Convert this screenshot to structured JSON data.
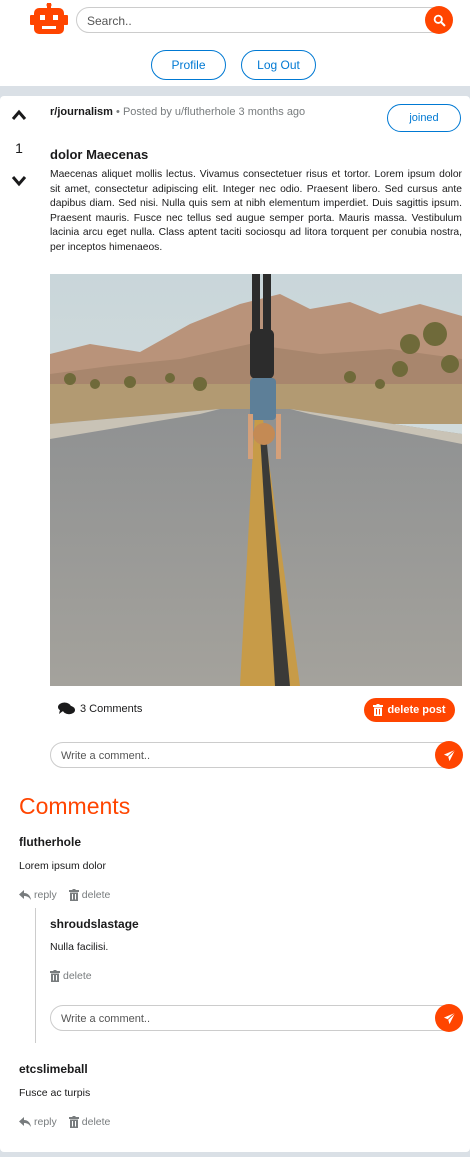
{
  "header": {
    "logo_icon": "robot-icon",
    "search_placeholder": "Search..",
    "search_icon": "search-icon",
    "profile_label": "Profile",
    "logout_label": "Log Out"
  },
  "post": {
    "votes": "1",
    "subreddit": "r/journalism",
    "posted_by": "• Posted by u/flutherhole 3 months ago",
    "joined_label": "joined",
    "title": "dolor Maecenas",
    "body": "Maecenas aliquet mollis lectus. Vivamus consectetuer risus et tortor. Lorem ipsum dolor sit amet, consectetur adipiscing elit. Integer nec odio. Praesent libero. Sed cursus ante dapibus diam. Sed nisi. Nulla quis sem at nibh elementum imperdiet. Duis sagittis ipsum. Praesent mauris. Fusce nec tellus sed augue semper porta. Mauris massa. Vestibulum lacinia arcu eget nulla. Class aptent taciti sociosqu ad litora torquent per conubia nostra, per inceptos himenaeos.",
    "comments_count": "3 Comments",
    "delete_post_label": "delete post",
    "comment_placeholder": "Write a comment.."
  },
  "comments_heading": "Comments",
  "comments": [
    {
      "author": "flutherhole",
      "text": "Lorem ipsum dolor",
      "reply_label": "reply",
      "delete_label": "delete"
    },
    {
      "author": "shroudslastage",
      "text": "Nulla facilisi.",
      "delete_label": "delete",
      "reply_placeholder": "Write a comment.."
    },
    {
      "author": "etcslimeball",
      "text": "Fusce ac turpis",
      "reply_label": "reply",
      "delete_label": "delete"
    }
  ],
  "colors": {
    "accent": "#ff4500",
    "link_blue": "#0079d3",
    "background": "#dae0e6"
  }
}
